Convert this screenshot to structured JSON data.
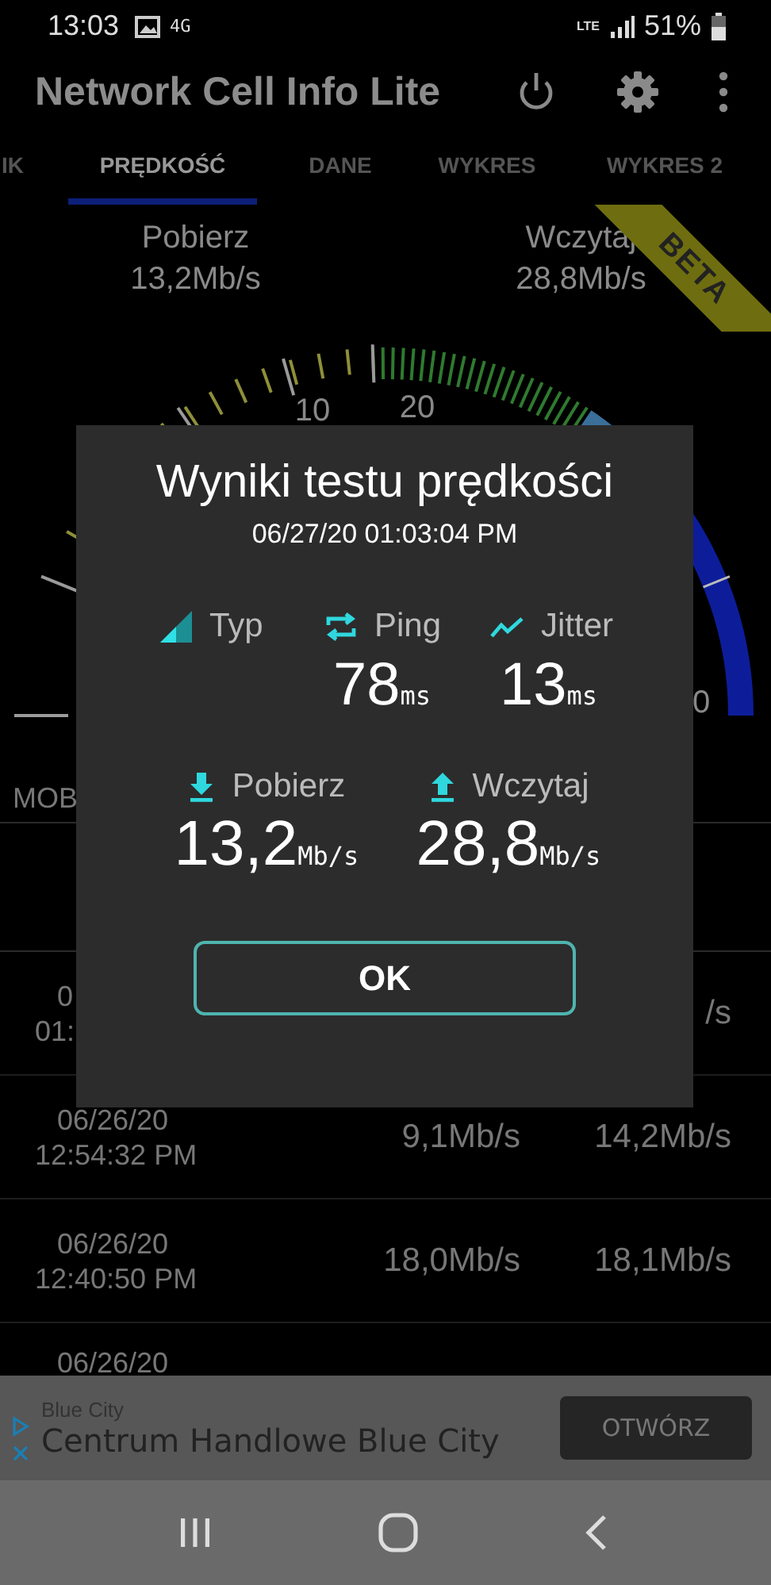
{
  "status_bar": {
    "time": "13:03",
    "network": "4G",
    "lte": "LTE",
    "battery": "51%"
  },
  "app_bar": {
    "title": "Network Cell Info Lite"
  },
  "tabs": [
    {
      "label": "IK",
      "selected": false
    },
    {
      "label": "PRĘDKOŚĆ",
      "selected": true
    },
    {
      "label": "DANE",
      "selected": false
    },
    {
      "label": "WYKRES",
      "selected": false
    },
    {
      "label": "WYKRES 2",
      "selected": false
    }
  ],
  "speeds": [
    {
      "label": "Pobierz",
      "value": "13,2Mb/s"
    },
    {
      "label": "Wczytaj",
      "value": "28,8Mb/s"
    }
  ],
  "ribbon": "BETA",
  "gauge": {
    "labels": [
      "10",
      "20",
      "0"
    ]
  },
  "section_label": "MOB",
  "history": [
    {
      "date": "0",
      "time": "01:",
      "upload": "/s"
    },
    {
      "date": "06/26/20",
      "time": "12:54:32 PM",
      "download": "9,1Mb/s",
      "upload": "14,2Mb/s"
    },
    {
      "date": "06/26/20",
      "time": "12:40:50 PM",
      "download": "18,0Mb/s",
      "upload": "18,1Mb/s"
    },
    {
      "date": "06/26/20"
    }
  ],
  "dialog": {
    "title": "Wyniki testu prędkości",
    "timestamp": "06/27/20 01:03:04 PM",
    "stats_top": [
      {
        "kind": "type",
        "label": "Typ"
      },
      {
        "kind": "ping",
        "label": "Ping",
        "value": "78",
        "unit": "ms"
      },
      {
        "kind": "jitter",
        "label": "Jitter",
        "value": "13",
        "unit": "ms"
      }
    ],
    "stats_bottom": [
      {
        "kind": "download",
        "label": "Pobierz",
        "value": "13,2",
        "unit": "Mb/s"
      },
      {
        "kind": "upload",
        "label": "Wczytaj",
        "value": "28,8",
        "unit": "Mb/s"
      }
    ],
    "button": "OK"
  },
  "ad": {
    "advertiser": "Blue City",
    "headline": "Centrum Handlowe Blue City",
    "button": "OTWÓRZ"
  }
}
